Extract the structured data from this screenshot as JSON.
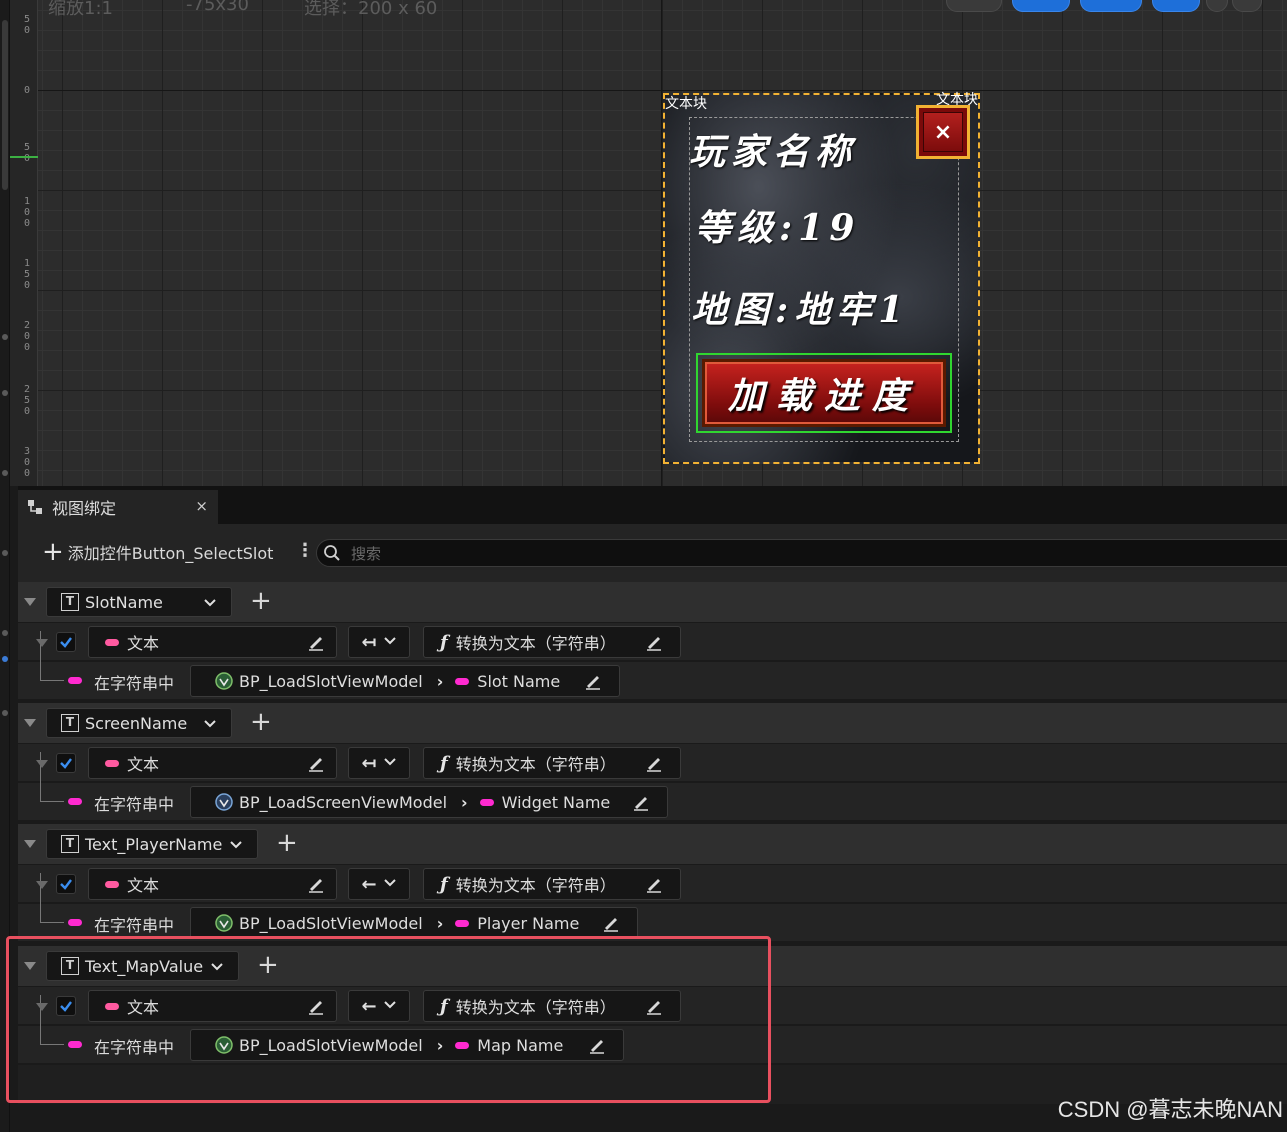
{
  "canvas": {
    "top_ghost": [
      {
        "text": "缩放1:1"
      },
      {
        "text": "-75x30"
      },
      {
        "text": "选择：200 x 60"
      }
    ],
    "ruler_ticks": [
      {
        "label": "5\n0"
      },
      {
        "label": "0"
      },
      {
        "label": "5\n0"
      },
      {
        "label": "1\n0\n0"
      },
      {
        "label": "1\n5\n0"
      },
      {
        "label": "2\n0\n0"
      },
      {
        "label": "2\n5\n0"
      },
      {
        "label": "3\n0\n0"
      }
    ],
    "widget": {
      "block_label_left": "文本块",
      "block_label_right": "文本块",
      "player_name": "玩家名称",
      "level": "等级:19",
      "map": "地图:地牢1",
      "close_label": "×",
      "load_button": "加载进度"
    }
  },
  "panel": {
    "tab_title": "视图绑定",
    "tab_close": "×",
    "add_label": "添加控件Button_SelectSlot",
    "search_placeholder": "搜索",
    "groups": [
      {
        "widget": "SlotName",
        "property": "文本",
        "direction": "↤",
        "converter": "转换为文本（字符串）",
        "source_label": "在字符串中",
        "viewmodel": "BP_LoadSlotViewModel",
        "field": "Slot Name"
      },
      {
        "widget": "ScreenName",
        "property": "文本",
        "direction": "↤",
        "converter": "转换为文本（字符串）",
        "source_label": "在字符串中",
        "viewmodel": "BP_LoadScreenViewModel",
        "field": "Widget Name"
      },
      {
        "widget": "Text_PlayerName",
        "property": "文本",
        "direction": "←",
        "converter": "转换为文本（字符串）",
        "source_label": "在字符串中",
        "viewmodel": "BP_LoadSlotViewModel",
        "field": "Player Name"
      },
      {
        "widget": "Text_MapValue",
        "property": "文本",
        "direction": "←",
        "converter": "转换为文本（字符串）",
        "source_label": "在字符串中",
        "viewmodel": "BP_LoadSlotViewModel",
        "field": "Map Name"
      }
    ]
  },
  "watermark": "CSDN @暮志未晚NAN",
  "colors": {
    "highlight": "#e8505f",
    "selection_dash": "#f2b233",
    "button_outline": "#30d630",
    "checkbox": "#3b8ef0",
    "pin_pink": "#ff5aa0",
    "pin_magenta": "#ff2ad0"
  }
}
